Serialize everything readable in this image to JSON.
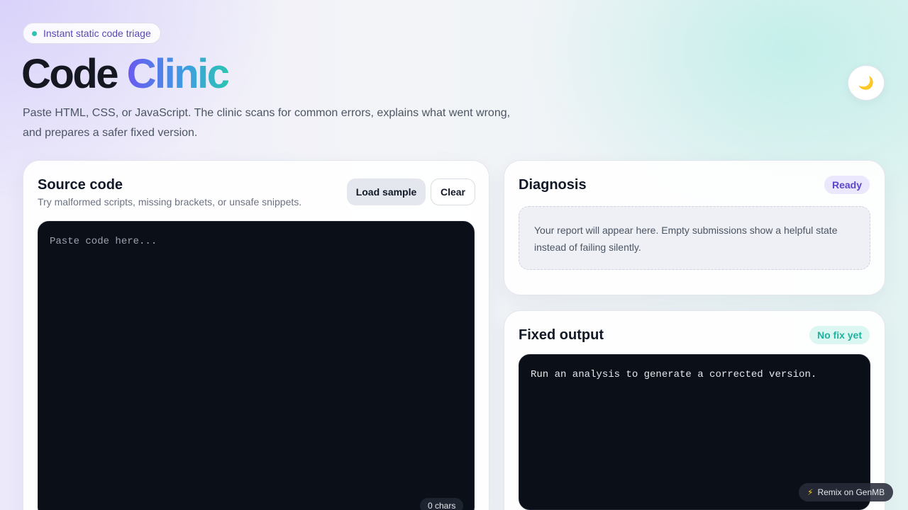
{
  "badge": {
    "label": "Instant static code triage"
  },
  "title": {
    "part1": "Code",
    "part2": "Clinic"
  },
  "subtitle": "Paste HTML, CSS, or JavaScript. The clinic scans for common errors, explains what went wrong, and prepares a safer fixed version.",
  "theme_toggle": {
    "icon": "moon-icon",
    "glyph": "🌙"
  },
  "source": {
    "title": "Source code",
    "hint": "Try malformed scripts, missing brackets, or unsafe snippets.",
    "load_sample_label": "Load sample",
    "clear_label": "Clear",
    "placeholder": "Paste code here...",
    "char_count": "0 chars"
  },
  "diagnosis": {
    "title": "Diagnosis",
    "status": "Ready",
    "empty_message": "Your report will appear here. Empty submissions show a helpful state instead of failing silently."
  },
  "fixed": {
    "title": "Fixed output",
    "status": "No fix yet",
    "message": "Run an analysis to generate a corrected version."
  },
  "remix": {
    "label": "Remix on GenMB",
    "icon": "bolt-icon",
    "glyph": "⚡"
  },
  "colors": {
    "accent_purple": "#6a58f0",
    "accent_teal": "#2cc4b2",
    "editor_bg": "#0b0f17"
  }
}
